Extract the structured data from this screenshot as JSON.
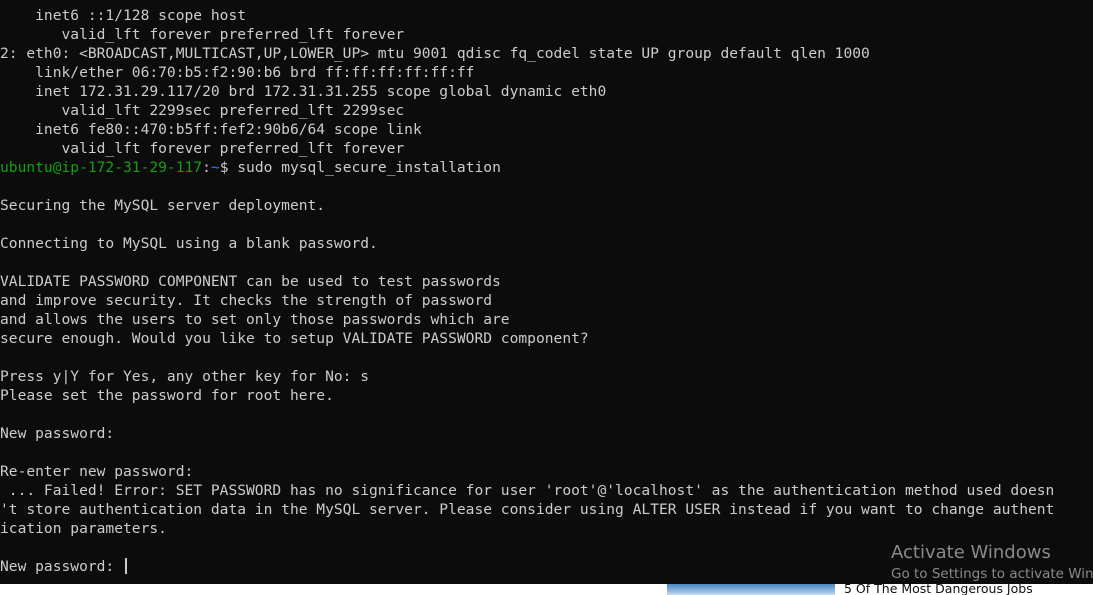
{
  "terminal": {
    "lines": [
      "    inet6 ::1/128 scope host",
      "       valid_lft forever preferred_lft forever",
      "2: eth0: <BROADCAST,MULTICAST,UP,LOWER_UP> mtu 9001 qdisc fq_codel state UP group default qlen 1000",
      "    link/ether 06:70:b5:f2:90:b6 brd ff:ff:ff:ff:ff:ff",
      "    inet 172.31.29.117/20 brd 172.31.31.255 scope global dynamic eth0",
      "       valid_lft 2299sec preferred_lft 2299sec",
      "    inet6 fe80::470:b5ff:fef2:90b6/64 scope link",
      "       valid_lft forever preferred_lft forever"
    ],
    "prompt": {
      "user_host": "ubuntu@ip-172-31-29-117",
      "colon": ":",
      "path": "~",
      "symbol": "$ ",
      "command": "sudo mysql_secure_installation"
    },
    "output": [
      "",
      "Securing the MySQL server deployment.",
      "",
      "Connecting to MySQL using a blank password.",
      "",
      "VALIDATE PASSWORD COMPONENT can be used to test passwords",
      "and improve security. It checks the strength of password",
      "and allows the users to set only those passwords which are",
      "secure enough. Would you like to setup VALIDATE PASSWORD component?",
      "",
      "Press y|Y for Yes, any other key for No: s",
      "Please set the password for root here.",
      "",
      "New password:",
      "",
      "Re-enter new password:",
      " ... Failed! Error: SET PASSWORD has no significance for user 'root'@'localhost' as the authentication method used doesn",
      "'t store authentication data in the MySQL server. Please consider using ALTER USER instead if you want to change authent",
      "ication parameters.",
      ""
    ],
    "current_input_prompt": "New password: "
  },
  "watermark": {
    "title": "Activate Windows",
    "subtitle": "Go to Settings to activate Windows."
  },
  "bottom_strip": {
    "headline": "5 Of The Most Dangerous Jobs"
  },
  "colors": {
    "background": "#0c0c0c",
    "text": "#cccccc",
    "prompt_user": "#13a10e",
    "prompt_path": "#3b78ff"
  }
}
